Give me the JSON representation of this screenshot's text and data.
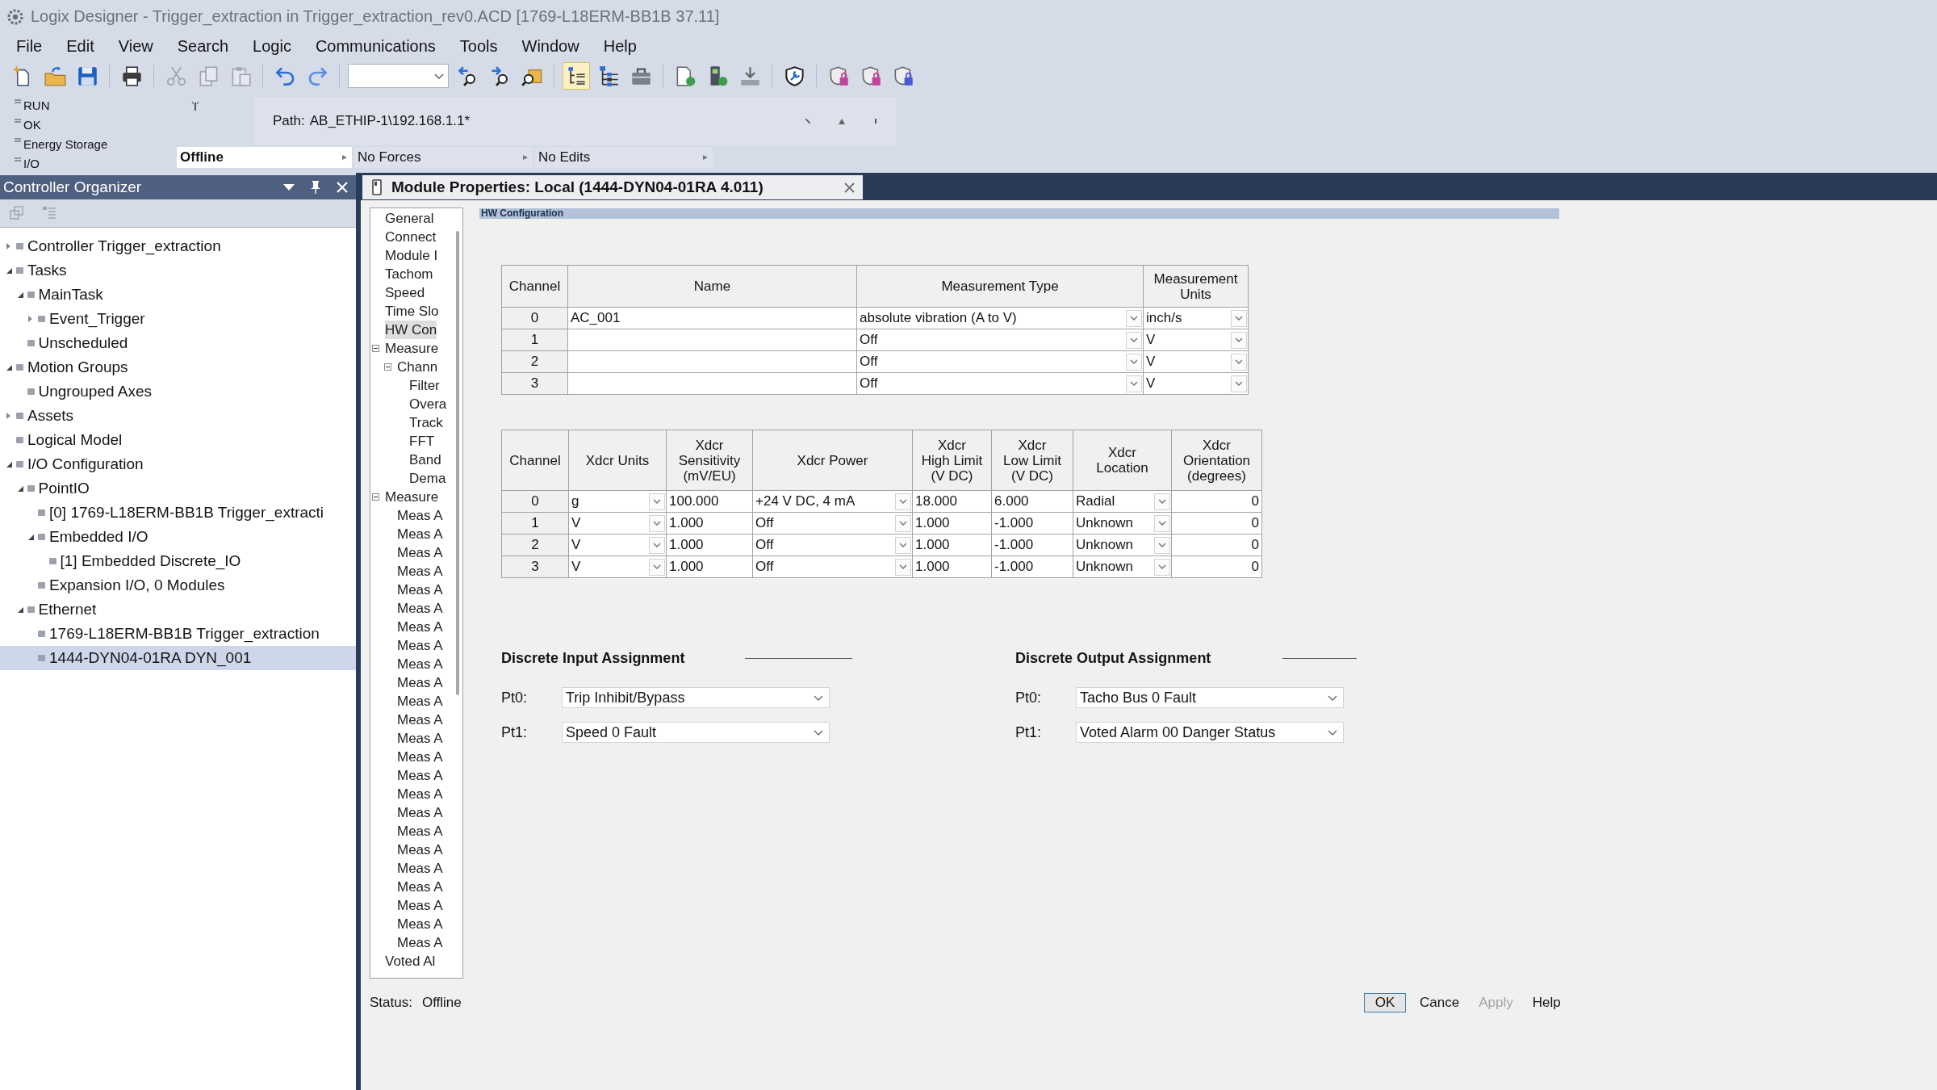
{
  "window": {
    "title": "Logix Designer - Trigger_extraction in Trigger_extraction_rev0.ACD [1769-L18ERM-BB1B 37.11]"
  },
  "menu": [
    "File",
    "Edit",
    "View",
    "Search",
    "Logic",
    "Communications",
    "Tools",
    "Window",
    "Help"
  ],
  "toolbar": [
    {
      "kind": "button",
      "pressed": false,
      "disabled": false
    },
    {
      "kind": "button",
      "pressed": false,
      "disabled": false
    },
    {
      "kind": "button",
      "pressed": false,
      "disabled": false
    },
    {
      "kind": "separator"
    },
    {
      "kind": "button",
      "pressed": false,
      "disabled": false
    },
    {
      "kind": "separator"
    },
    {
      "kind": "button",
      "pressed": false,
      "disabled": true
    },
    {
      "kind": "button",
      "pressed": false,
      "disabled": true
    },
    {
      "kind": "button",
      "pressed": false,
      "disabled": true
    },
    {
      "kind": "separator"
    },
    {
      "kind": "button",
      "pressed": false,
      "disabled": false
    },
    {
      "kind": "button",
      "pressed": false,
      "disabled": false
    },
    {
      "kind": "separator"
    },
    {
      "kind": "combo"
    },
    {
      "kind": "button",
      "pressed": false,
      "disabled": false
    },
    {
      "kind": "button",
      "pressed": false,
      "disabled": false
    },
    {
      "kind": "button",
      "pressed": false,
      "disabled": false
    },
    {
      "kind": "separator"
    },
    {
      "kind": "button",
      "pressed": true,
      "disabled": false
    },
    {
      "kind": "button",
      "pressed": false,
      "disabled": false
    },
    {
      "kind": "button",
      "pressed": false,
      "disabled": false
    },
    {
      "kind": "separator"
    },
    {
      "kind": "button",
      "pressed": false,
      "disabled": false
    },
    {
      "kind": "button",
      "pressed": false,
      "disabled": false
    },
    {
      "kind": "button",
      "pressed": false,
      "disabled": false
    },
    {
      "kind": "separator"
    },
    {
      "kind": "button",
      "pressed": false,
      "disabled": false
    },
    {
      "kind": "separator"
    },
    {
      "kind": "button",
      "pressed": false,
      "disabled": false
    },
    {
      "kind": "button",
      "pressed": false,
      "disabled": false
    },
    {
      "kind": "button",
      "pressed": false,
      "disabled": false
    }
  ],
  "controller_status": {
    "indicators": [
      {
        "label": "RUN",
        "on": false
      },
      {
        "label": "OK",
        "on": false
      },
      {
        "label": "Energy Storage",
        "on": false
      },
      {
        "label": "I/O",
        "on": false
      }
    ]
  },
  "path": {
    "label": "Path:",
    "value": "AB_ETHIP-1\\192.168.1.1*"
  },
  "status_fields": [
    {
      "text": "Offline",
      "highlighted": true
    },
    {
      "text": "No Forces",
      "highlighted": false
    },
    {
      "text": "No Edits",
      "highlighted": false
    }
  ],
  "organizer": {
    "title": "Controller Organizer",
    "tree": [
      {
        "label": "Controller Trigger_extraction",
        "expanded": false,
        "selected": false
      },
      {
        "label": "Tasks",
        "expanded": true,
        "selected": false,
        "children": [
          {
            "label": "MainTask",
            "expanded": true,
            "selected": false,
            "children": [
              {
                "label": "Event_Trigger",
                "expanded": false,
                "selected": false
              }
            ]
          },
          {
            "label": "Unscheduled",
            "selected": false
          }
        ]
      },
      {
        "label": "Motion Groups",
        "expanded": true,
        "selected": false,
        "children": [
          {
            "label": "Ungrouped Axes",
            "selected": false
          }
        ]
      },
      {
        "label": "Assets",
        "expanded": false,
        "selected": false
      },
      {
        "label": "Logical Model",
        "selected": false
      },
      {
        "label": "I/O Configuration",
        "expanded": true,
        "selected": false,
        "children": [
          {
            "label": "PointIO",
            "expanded": true,
            "selected": false,
            "children": [
              {
                "label": "[0] 1769-L18ERM-BB1B Trigger_extracti",
                "selected": false
              },
              {
                "label": "Embedded I/O",
                "expanded": true,
                "selected": false,
                "children": [
                  {
                    "label": "[1] Embedded Discrete_IO",
                    "selected": false
                  }
                ]
              },
              {
                "label": "Expansion I/O, 0 Modules",
                "selected": false
              }
            ]
          },
          {
            "label": "Ethernet",
            "expanded": true,
            "selected": false,
            "children": [
              {
                "label": "1769-L18ERM-BB1B Trigger_extraction",
                "selected": false
              },
              {
                "label": "1444-DYN04-01RA DYN_001",
                "selected": true
              }
            ]
          }
        ]
      }
    ]
  },
  "editor_tab": {
    "title": "Module Properties: Local (1444-DYN04-01RA 4.011)"
  },
  "dialog": {
    "categories": [
      {
        "label": "General",
        "selected": false
      },
      {
        "label": "Connect",
        "selected": false
      },
      {
        "label": "Module I",
        "selected": false
      },
      {
        "label": "Tachom",
        "selected": false
      },
      {
        "label": "Speed",
        "selected": false
      },
      {
        "label": "Time Slo",
        "selected": false
      },
      {
        "label": "HW Con",
        "selected": true
      },
      {
        "label": "Measure",
        "expanded": true,
        "selected": false,
        "children": [
          {
            "label": "Chann",
            "expanded": true,
            "selected": false,
            "children": [
              {
                "label": "Filter",
                "selected": false
              },
              {
                "label": "Overa",
                "selected": false
              },
              {
                "label": "Track",
                "selected": false
              },
              {
                "label": "FFT",
                "selected": false
              },
              {
                "label": "Band",
                "selected": false
              },
              {
                "label": "Dema",
                "selected": false
              }
            ]
          }
        ]
      },
      {
        "label": "Measure",
        "expanded": true,
        "selected": false,
        "children": [
          {
            "label": "Meas A",
            "selected": false
          },
          {
            "label": "Meas A",
            "selected": false
          },
          {
            "label": "Meas A",
            "selected": false
          },
          {
            "label": "Meas A",
            "selected": false
          },
          {
            "label": "Meas A",
            "selected": false
          },
          {
            "label": "Meas A",
            "selected": false
          },
          {
            "label": "Meas A",
            "selected": false
          },
          {
            "label": "Meas A",
            "selected": false
          },
          {
            "label": "Meas A",
            "selected": false
          },
          {
            "label": "Meas A",
            "selected": false
          },
          {
            "label": "Meas A",
            "selected": false
          },
          {
            "label": "Meas A",
            "selected": false
          },
          {
            "label": "Meas A",
            "selected": false
          },
          {
            "label": "Meas A",
            "selected": false
          },
          {
            "label": "Meas A",
            "selected": false
          },
          {
            "label": "Meas A",
            "selected": false
          },
          {
            "label": "Meas A",
            "selected": false
          },
          {
            "label": "Meas A",
            "selected": false
          },
          {
            "label": "Meas A",
            "selected": false
          },
          {
            "label": "Meas A",
            "selected": false
          },
          {
            "label": "Meas A",
            "selected": false
          },
          {
            "label": "Meas A",
            "selected": false
          },
          {
            "label": "Meas A",
            "selected": false
          },
          {
            "label": "Meas A",
            "selected": false
          }
        ]
      },
      {
        "label": "Voted Al",
        "selected": false
      }
    ],
    "section": "HW Configuration",
    "channel_table": {
      "columns": [
        {
          "label": "Channel",
          "kind": "index"
        },
        {
          "label": "Name",
          "kind": "text"
        },
        {
          "label": "Measurement Type",
          "kind": "dropdown"
        },
        {
          "label": "Measurement\nUnits",
          "kind": "dropdown"
        }
      ],
      "rows": [
        [
          "0",
          "AC_001",
          "absolute vibration (A to V)",
          "inch/s"
        ],
        [
          "1",
          null,
          "Off",
          "V"
        ],
        [
          "2",
          null,
          "Off",
          "V"
        ],
        [
          "3",
          null,
          "Off",
          "V"
        ]
      ]
    },
    "transducer_table": {
      "columns": [
        {
          "label": "Channel",
          "kind": "index"
        },
        {
          "label": "Xdcr Units",
          "kind": "dropdown"
        },
        {
          "label": "Xdcr\nSensitivity\n(mV/EU)",
          "kind": "text"
        },
        {
          "label": "Xdcr Power",
          "kind": "dropdown"
        },
        {
          "label": "Xdcr\nHigh Limit\n(V DC)",
          "kind": "text"
        },
        {
          "label": "Xdcr\nLow Limit\n(V DC)",
          "kind": "text"
        },
        {
          "label": "Xdcr\nLocation",
          "kind": "dropdown"
        },
        {
          "label": "Xdcr\nOrientation\n(degrees)",
          "kind": "number"
        }
      ],
      "rows": [
        [
          "0",
          "g",
          "100.000",
          "+24 V DC, 4 mA",
          "18.000",
          "6.000",
          "Radial",
          "0"
        ],
        [
          "1",
          "V",
          "1.000",
          "Off",
          "1.000",
          "-1.000",
          "Unknown",
          "0"
        ],
        [
          "2",
          "V",
          "1.000",
          "Off",
          "1.000",
          "-1.000",
          "Unknown",
          "0"
        ],
        [
          "3",
          "V",
          "1.000",
          "Off",
          "1.000",
          "-1.000",
          "Unknown",
          "0"
        ]
      ]
    },
    "discrete_input": {
      "title": "Discrete Input Assignment",
      "points": [
        {
          "label": "Pt0:",
          "value": "Trip Inhibit/Bypass"
        },
        {
          "label": "Pt1:",
          "value": "Speed 0 Fault"
        }
      ]
    },
    "discrete_output": {
      "title": "Discrete Output Assignment",
      "points": [
        {
          "label": "Pt0:",
          "value": "Tacho Bus 0 Fault"
        },
        {
          "label": "Pt1:",
          "value": "Voted Alarm 00 Danger Status"
        }
      ]
    },
    "status": {
      "label": "Status:",
      "value": "Offline"
    },
    "buttons": [
      {
        "label": "OK",
        "default": true,
        "disabled": false
      },
      {
        "label": "Cance",
        "default": false,
        "disabled": false
      },
      {
        "label": "Apply",
        "default": false,
        "disabled": true
      },
      {
        "label": "Help",
        "default": false,
        "disabled": false
      }
    ]
  }
}
